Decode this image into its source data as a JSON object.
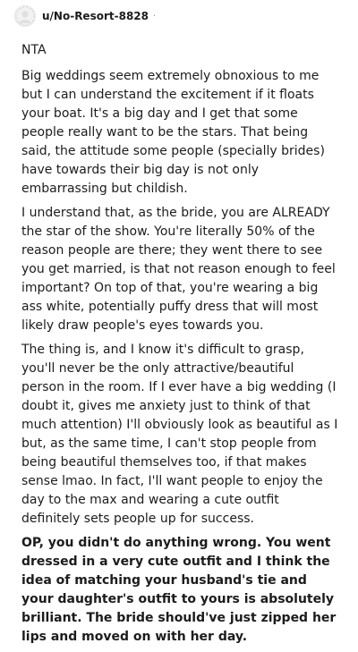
{
  "comment": {
    "username": "u/No-Resort-8828",
    "separator": "·",
    "paragraphs": [
      "NTA",
      "Big weddings seem extremely obnoxious to me but I can understand the excitement if it floats your boat. It's a big day and I get that some people really want to be the stars. That being said, the attitude some people (specially brides) have towards their big day is not only embarrassing but childish.",
      "I understand that, as the bride, you are ALREADY the star of the show. You're literally 50% of the reason people are there; they went there to see you get married, is that not reason enough to feel important? On top of that, you're wearing a big ass white, potentially puffy dress that will most likely draw people's eyes towards you.",
      "The thing is, and I know it's difficult to grasp, you'll never be the only attractive/beautiful person in the room. If I ever have a big wedding (I doubt it, gives me anxiety just to think of that much attention) I'll obviously look as beautiful as I but, as the same time, I can't stop people from being beautiful themselves too, if that makes sense lmao. In fact, I'll want people to enjoy the day to the max and wearing a cute outfit definitely sets people up for success.",
      "OP, you didn't do anything wrong. You went dressed in a very cute outfit and I think the idea of matching your husband's tie and your daughter's outfit to yours is absolutely brilliant. The bride should've just zipped her lips and moved on with her day."
    ]
  }
}
